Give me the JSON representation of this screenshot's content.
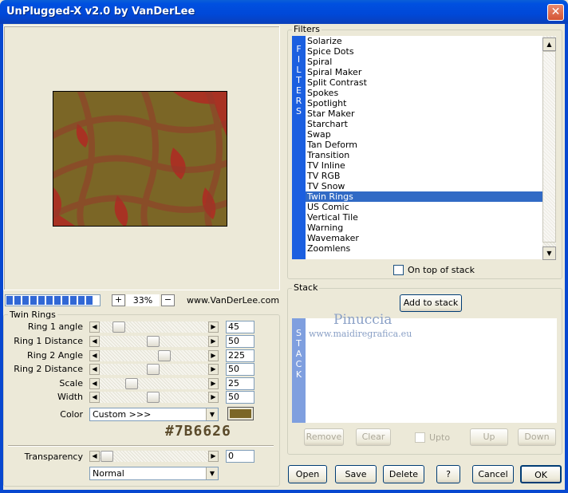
{
  "window": {
    "title": "UnPlugged-X v2.0 by VanDerLee",
    "close_glyph": "✕"
  },
  "preview": {
    "zoom": "33%",
    "zoom_plus": "+",
    "zoom_minus": "−",
    "website": "www.VanDerLee.com",
    "progress_segments": 10
  },
  "twin_rings": {
    "group_label": "Twin Rings",
    "sliders": [
      {
        "label": "Ring 1 angle",
        "value": "45"
      },
      {
        "label": "Ring 1 Distance",
        "value": "50"
      },
      {
        "label": "Ring 2 Angle",
        "value": "225"
      },
      {
        "label": "Ring 2 Distance",
        "value": "50"
      },
      {
        "label": "Scale",
        "value": "25"
      },
      {
        "label": "Width",
        "value": "50"
      }
    ],
    "color_label": "Color",
    "color_select": "Custom >>>",
    "color_hex": "#7B6626",
    "swatch_color": "#7b6626",
    "transparency_label": "Transparency",
    "transparency_value": "0",
    "blend_mode": "Normal"
  },
  "filters": {
    "group_label": "Filters",
    "side_label": "FILTERS",
    "items": [
      "Solarize",
      "Spice Dots",
      "Spiral",
      "Spiral Maker",
      "Split Contrast",
      "Spokes",
      "Spotlight",
      "Star Maker",
      "Starchart",
      "Swap",
      "Tan Deform",
      "Transition",
      "TV Inline",
      "TV RGB",
      "TV Snow",
      "Twin Rings",
      "US Comic",
      "Vertical Tile",
      "Warning",
      "Wavemaker",
      "Zoomlens"
    ],
    "selected": "Twin Rings",
    "on_top_label": "On top of stack"
  },
  "stack": {
    "group_label": "Stack",
    "side_label": "STACK",
    "add_label": "Add to stack",
    "remove_label": "Remove",
    "clear_label": "Clear",
    "upto_label": "Upto",
    "up_label": "Up",
    "down_label": "Down"
  },
  "watermark": {
    "name": "Pinuccia",
    "site": "www.maidiregrafica.eu"
  },
  "buttons": {
    "open": "Open",
    "save": "Save",
    "delete": "Delete",
    "help": "?",
    "cancel": "Cancel",
    "ok": "OK"
  },
  "colors": {
    "accent_blue": "#316ac5",
    "strip_blue": "#1b5fe0",
    "stack_strip": "#7f9fdf",
    "preview_red": "#b02a23"
  }
}
